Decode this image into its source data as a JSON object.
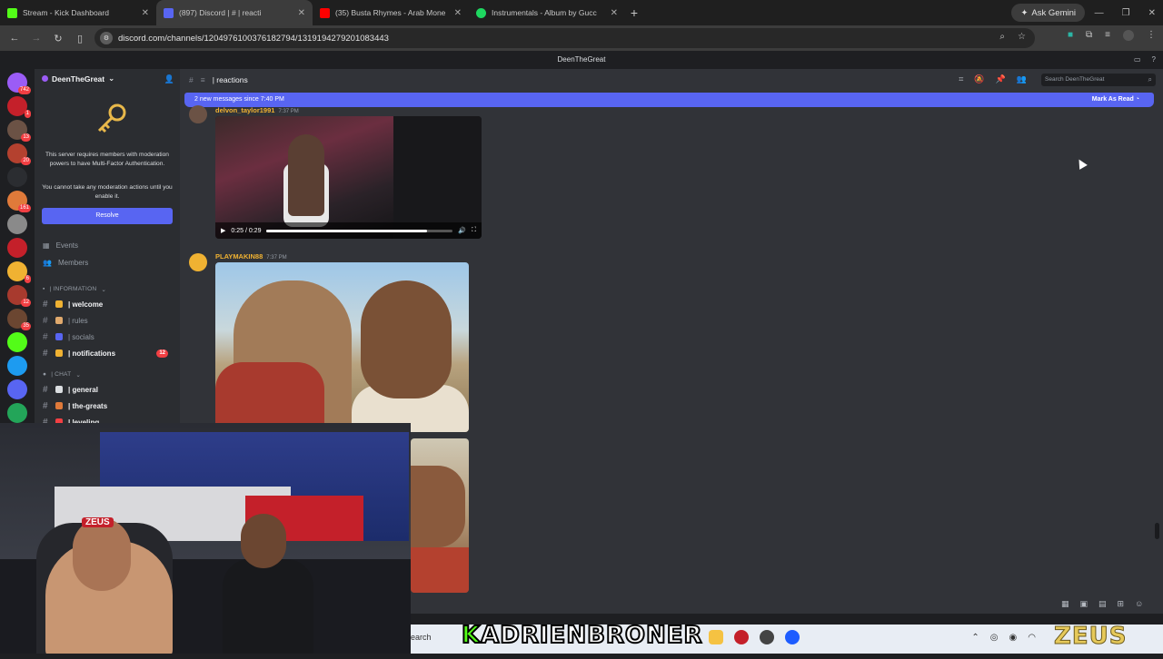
{
  "browser": {
    "tabs": [
      {
        "title": "Stream - Kick Dashboard",
        "color": "#53fc18",
        "active": false
      },
      {
        "title": "(897) Discord | # ⁠| reacti",
        "color": "#5865f2",
        "active": true
      },
      {
        "title": "(35) Busta Rhymes - Arab Mone",
        "color": "#ff0000",
        "active": false
      },
      {
        "title": "Instrumentals - Album by Gucc",
        "color": "#1ed760",
        "active": false
      }
    ],
    "gemini_label": "Ask Gemini",
    "url": "discord.com/channels/1204976100376182794/1319194279201083443"
  },
  "discord": {
    "window_title": "DeenTheGreat",
    "server_name": "DeenTheGreat",
    "mfa_message": "This server requires members with moderation powers to have Multi-Factor Authentication.",
    "mfa_warning": "You cannot take any moderation actions until you enable it.",
    "resolve_label": "Resolve",
    "nav": [
      {
        "label": "Events",
        "icon": "calendar-icon"
      },
      {
        "label": "Members",
        "icon": "members-icon"
      }
    ],
    "categories": [
      {
        "label": "| INFORMATION",
        "channels": [
          {
            "label": "| welcome",
            "bright": true,
            "emoji_color": "#f0b232"
          },
          {
            "label": "| rules",
            "bright": false,
            "emoji_color": "#e0a96d"
          },
          {
            "label": "| socials",
            "bright": false,
            "emoji_color": "#5865f2"
          },
          {
            "label": "| notifications",
            "bright": true,
            "emoji_color": "#f0b232",
            "mentions": "12"
          }
        ]
      },
      {
        "label": "| CHAT",
        "channels": [
          {
            "label": "| general",
            "bright": true,
            "emoji_color": "#dbdee1"
          },
          {
            "label": "| the-greats",
            "bright": true,
            "emoji_color": "#e07a3a"
          },
          {
            "label": "| leveling",
            "bright": true,
            "emoji_color": "#f23f43"
          }
        ]
      }
    ],
    "channel_header": "| reactions",
    "search_placeholder": "Search DeenTheGreat",
    "new_messages": "2 new messages since 7:40 PM",
    "mark_as_read": "Mark As Read",
    "messages": [
      {
        "author": "delvon_taylor1991",
        "time": "7:37 PM",
        "video_time": "0:25 / 0:29",
        "progress": 0.86
      },
      {
        "author": "PLAYMAKIN88",
        "time": "7:37 PM"
      }
    ],
    "server_badges": [
      "742",
      "1",
      "13",
      "20",
      "",
      "161",
      "",
      "",
      "6",
      "12",
      "35",
      "",
      "",
      "",
      "",
      ""
    ]
  },
  "overlay": {
    "streamer_name_prefix": "K",
    "streamer_name_rest": "ADRIENBRONER",
    "brand": "ZEUS",
    "taskbar_search": "earch"
  }
}
